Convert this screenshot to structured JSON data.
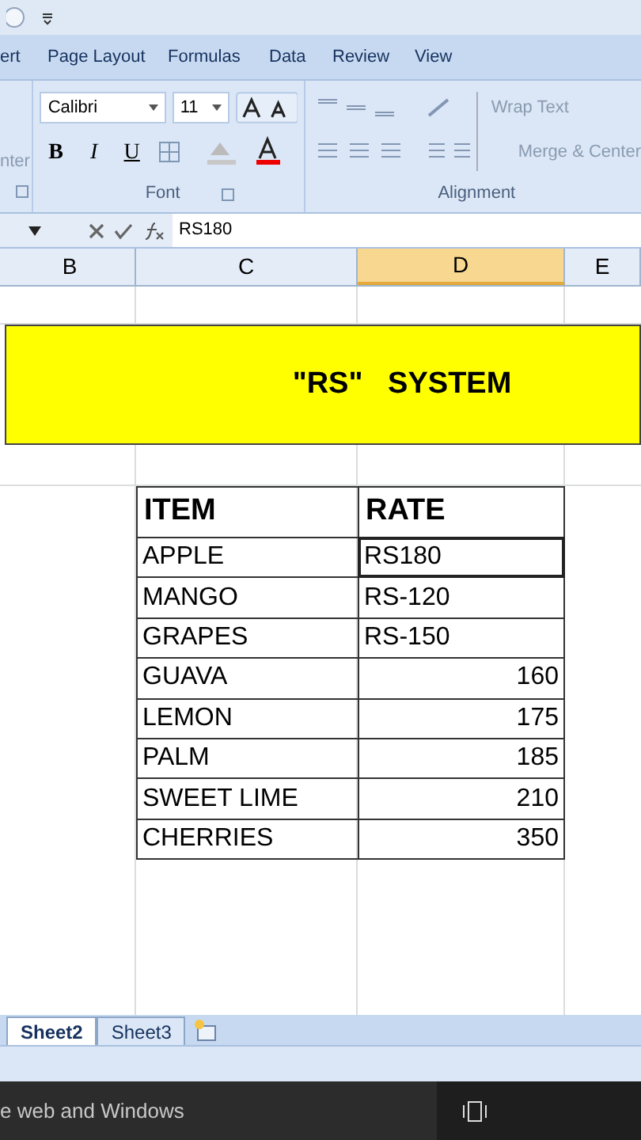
{
  "ribbon_tabs": [
    {
      "label": "ert",
      "selected": false
    },
    {
      "label": "Page Layout",
      "selected": false
    },
    {
      "label": "Formulas",
      "selected": false
    },
    {
      "label": "Data",
      "selected": false
    },
    {
      "label": "Review",
      "selected": false
    },
    {
      "label": "View",
      "selected": false
    }
  ],
  "ribbon": {
    "clipped_label": "nter",
    "font_name": "Calibri",
    "font_size": "11",
    "font_group": "Font",
    "alignment_group": "Alignment",
    "wrap_text": "Wrap Text",
    "merge_center": "Merge & Center",
    "format_buttons": [
      "B",
      "I",
      "U"
    ]
  },
  "formula_bar": {
    "value": "RS180"
  },
  "columns": [
    {
      "label": "B",
      "selected": false
    },
    {
      "label": "C",
      "selected": false
    },
    {
      "label": "D",
      "selected": true
    },
    {
      "label": "E",
      "selected": false
    }
  ],
  "title": "\"RS\"   SYSTEM",
  "table": {
    "headers": [
      "ITEM",
      "RATE"
    ],
    "rows": [
      {
        "item": "APPLE",
        "rate": "RS180",
        "kind": "text",
        "editing": true
      },
      {
        "item": "MANGO",
        "rate": "RS-120",
        "kind": "text",
        "editing": false
      },
      {
        "item": "GRAPES",
        "rate": "RS-150",
        "kind": "text",
        "editing": false
      },
      {
        "item": "GUAVA",
        "rate": "160",
        "kind": "number",
        "editing": false
      },
      {
        "item": "LEMON",
        "rate": "175",
        "kind": "number",
        "editing": false
      },
      {
        "item": "PALM",
        "rate": "185",
        "kind": "number",
        "editing": false
      },
      {
        "item": "SWEET LIME",
        "rate": "210",
        "kind": "number",
        "editing": false
      },
      {
        "item": "CHERRIES",
        "rate": "350",
        "kind": "number",
        "editing": false
      }
    ]
  },
  "sheet_tabs": [
    {
      "label": "Sheet2",
      "selected": true
    },
    {
      "label": "Sheet3",
      "selected": false
    }
  ],
  "taskbar": {
    "search_text": "e web and Windows"
  }
}
